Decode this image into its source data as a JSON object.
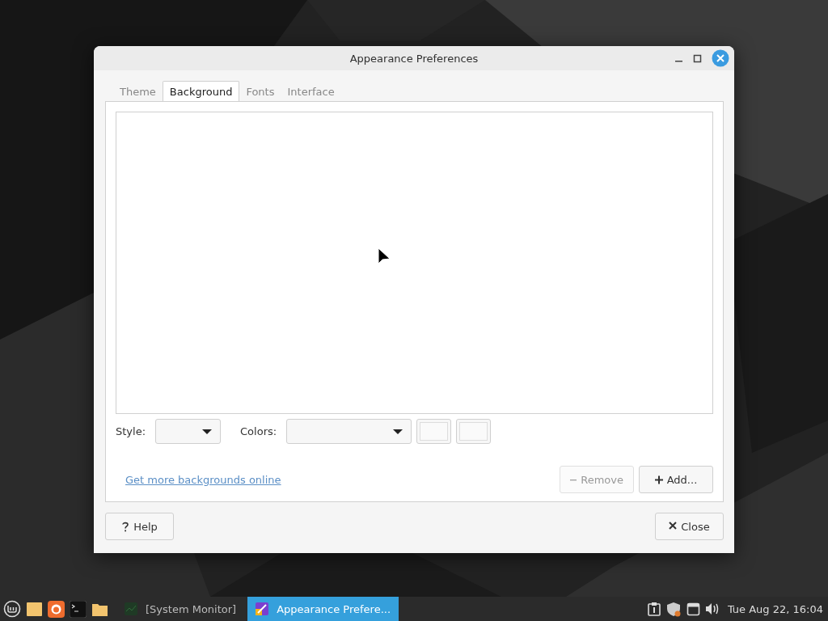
{
  "window": {
    "title": "Appearance Preferences"
  },
  "tabs": [
    {
      "label": "Theme",
      "selected": false
    },
    {
      "label": "Background",
      "selected": true
    },
    {
      "label": "Fonts",
      "selected": false
    },
    {
      "label": "Interface",
      "selected": false
    }
  ],
  "style_label": "Style:",
  "colors_label": "Colors:",
  "link": "Get more backgrounds online",
  "list_buttons": [
    {
      "label": "Remove",
      "kind": "remove",
      "disabled": true
    },
    {
      "label": "Add...",
      "kind": "add",
      "disabled": false
    }
  ],
  "dialog_buttons": [
    {
      "label": "Help",
      "kind": "help"
    },
    {
      "label": "Close",
      "kind": "close"
    }
  ],
  "taskbar": {
    "windows": [
      {
        "label": "[System Monitor]",
        "kind": "monitor",
        "selected": false
      },
      {
        "label": "Appearance Prefere...",
        "kind": "appearance",
        "selected": true
      }
    ],
    "clock": "Tue Aug 22, 16:04"
  }
}
